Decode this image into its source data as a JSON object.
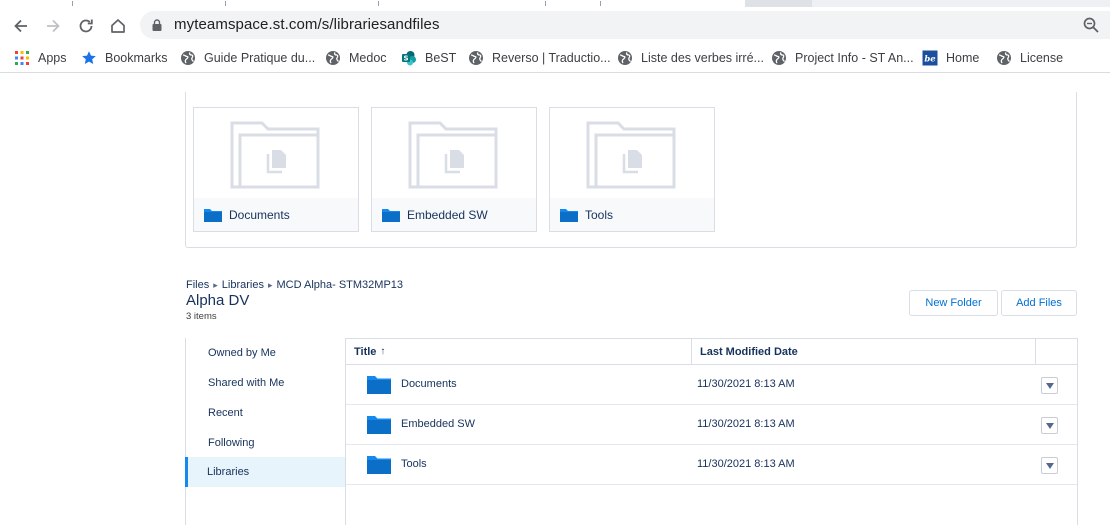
{
  "browser": {
    "url": "myteamspace.st.com/s/librariesandfiles",
    "bookmarks": [
      {
        "label": "Apps",
        "icon": "apps-grid-icon"
      },
      {
        "label": "Bookmarks",
        "icon": "star-icon"
      },
      {
        "label": "Guide Pratique du...",
        "icon": "globe-icon"
      },
      {
        "label": "Medoc",
        "icon": "globe-icon"
      },
      {
        "label": "BeST",
        "icon": "sharepoint-icon"
      },
      {
        "label": "Reverso | Traductio...",
        "icon": "globe-icon"
      },
      {
        "label": "Liste des verbes irré...",
        "icon": "globe-icon"
      },
      {
        "label": "Project Info - ST An...",
        "icon": "globe-icon"
      },
      {
        "label": "Home",
        "icon": "be-logo-icon"
      },
      {
        "label": "License",
        "icon": "globe-icon"
      }
    ]
  },
  "tiles": [
    {
      "label": "Documents"
    },
    {
      "label": "Embedded SW"
    },
    {
      "label": "Tools"
    }
  ],
  "breadcrumb": [
    "Files",
    "Libraries",
    "MCD Alpha- STM32MP13"
  ],
  "page": {
    "title": "Alpha DV",
    "item_count": "3 items"
  },
  "actions": {
    "new_folder": "New Folder",
    "add_files": "Add Files"
  },
  "sidenav": [
    {
      "label": "Owned by Me",
      "active": false
    },
    {
      "label": "Shared with Me",
      "active": false
    },
    {
      "label": "Recent",
      "active": false
    },
    {
      "label": "Following",
      "active": false
    },
    {
      "label": "Libraries",
      "active": true
    }
  ],
  "table": {
    "columns": {
      "title": "Title",
      "title_sort": "↑",
      "modified": "Last Modified Date"
    },
    "rows": [
      {
        "name": "Documents",
        "modified": "11/30/2021 8:13 AM"
      },
      {
        "name": "Embedded SW",
        "modified": "11/30/2021 8:13 AM"
      },
      {
        "name": "Tools",
        "modified": "11/30/2021 8:13 AM"
      }
    ]
  },
  "colors": {
    "link_blue": "#0070d2",
    "text_navy": "#16325c",
    "folder_blue": "#1589ee",
    "active_nav_bg": "#e8f4fb"
  }
}
